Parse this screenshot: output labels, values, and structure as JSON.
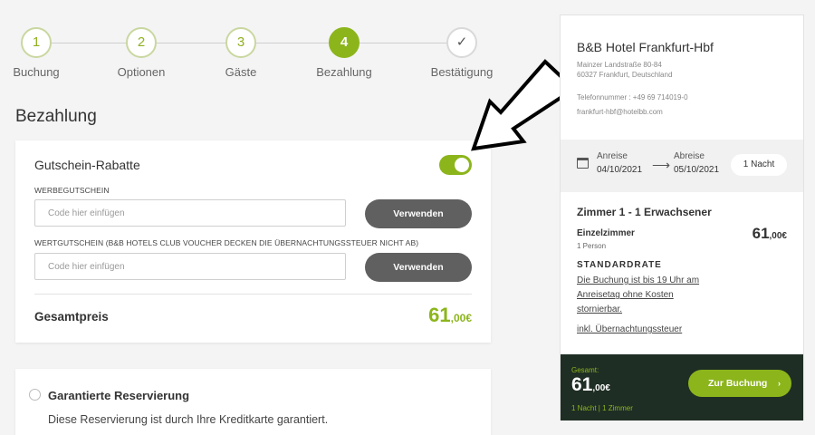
{
  "stepper": {
    "steps": [
      {
        "number": "1",
        "label": "Buchung"
      },
      {
        "number": "2",
        "label": "Optionen"
      },
      {
        "number": "3",
        "label": "Gäste"
      },
      {
        "number": "4",
        "label": "Bezahlung"
      },
      {
        "number": "✓",
        "label": "Bestätigung"
      }
    ],
    "active_step": 4
  },
  "page_title": "Bezahlung",
  "vouchers": {
    "title": "Gutschein-Rabatte",
    "toggle_on": true,
    "promo_label": "WERBEGUTSCHEIN",
    "promo_placeholder": "Code hier einfügen",
    "promo_button": "Verwenden",
    "value_label": "WERTGUTSCHEIN (B&B HOTELS CLUB VOUCHER DECKEN DIE ÜBERNACHTUNGSSTEUER NICHT AB)",
    "value_placeholder": "Code hier einfügen",
    "value_button": "Verwenden",
    "total_label": "Gesamtpreis",
    "total_main": "61",
    "total_cents": ",00€"
  },
  "guarantee": {
    "title": "Garantierte Reservierung",
    "text": "Diese Reservierung ist durch Ihre Kreditkarte garantiert."
  },
  "sidebar": {
    "hotel_name": "B&B Hotel Frankfurt-Hbf",
    "address_line1": "Mainzer Landstraße 80-84",
    "address_line2": "60327 Frankfurt, Deutschland",
    "phone": "Telefonnummer : +49 69 714019-0",
    "email": "frankfurt-hbf@hotelbb.com",
    "arrival_label": "Anreise",
    "arrival_date": "04/10/2021",
    "departure_label": "Abreise",
    "departure_date": "05/10/2021",
    "arrow": "⟶",
    "nights": "1 Nacht",
    "room_title": "Zimmer 1 - 1 Erwachsener",
    "room_type": "Einzelzimmer",
    "room_persons": "1 Person",
    "room_price_main": "61",
    "room_price_cents": ",00€",
    "rate_title": "STANDARDRATE",
    "rate_line1": "Die Buchung ist bis 19 Uhr am",
    "rate_line2": "Anreisetag ohne Kosten",
    "rate_line3": "stornierbar.",
    "tax_link": "inkl. Übernachtungssteuer",
    "summary_label": "Gesamt:",
    "summary_main": "61",
    "summary_cents": ",00€",
    "summary_sub": "1 Nacht | 1 Zimmer",
    "book_button": "Zur Buchung",
    "book_chevron": "›"
  },
  "colors": {
    "accent": "#8cb51c",
    "dark_bar": "#1f2e24",
    "button_gray": "#606060"
  }
}
